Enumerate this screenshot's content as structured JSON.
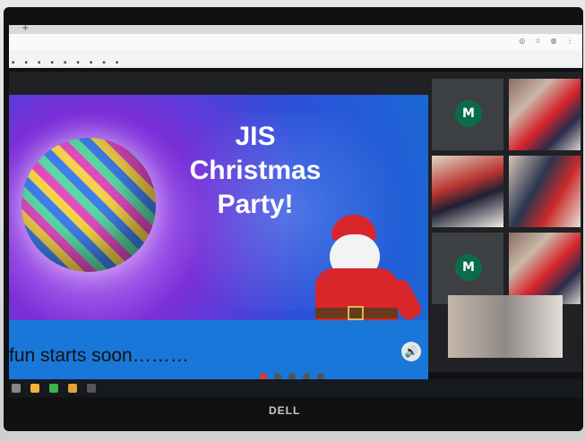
{
  "slide": {
    "title_line1": "JIS",
    "title_line2": "Christmas",
    "title_line3": "Party!",
    "footer_text": "fun starts soon………"
  },
  "participants": [
    {
      "initial": "M"
    },
    {
      "initial": "M"
    }
  ],
  "browser": {
    "bookmarks": [
      "",
      "",
      "",
      "",
      "",
      "",
      "",
      "",
      ""
    ]
  },
  "monitor": {
    "brand": "DELL"
  },
  "colors": {
    "slide_blue": "#1877d8",
    "avatar_green": "#0b6b4b"
  }
}
